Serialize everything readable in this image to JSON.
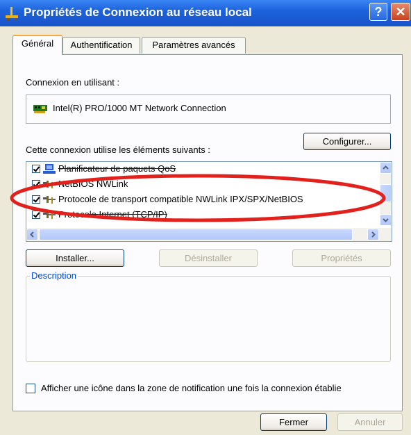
{
  "window": {
    "title": "Propriétés de Connexion au réseau local",
    "help_glyph": "?",
    "close_glyph": "✕"
  },
  "tabs": [
    {
      "label": "Général"
    },
    {
      "label": "Authentification"
    },
    {
      "label": "Paramètres avancés"
    }
  ],
  "general": {
    "connect_using_label": "Connexion en utilisant :",
    "adapter_name": "Intel(R) PRO/1000 MT Network Connection",
    "configure_button": "Configurer...",
    "items_label": "Cette connexion utilise les éléments suivants :",
    "items": [
      {
        "label": "Planificateur de paquets QoS",
        "checked": true,
        "icon": "scheduler-icon"
      },
      {
        "label": "NetBIOS NWLink",
        "checked": true,
        "icon": "protocol-icon"
      },
      {
        "label": "Protocole de transport compatible NWLink IPX/SPX/NetBIOS",
        "checked": true,
        "icon": "protocol-icon"
      },
      {
        "label": "Protocole Internet (TCP/IP)",
        "checked": true,
        "icon": "protocol-icon"
      }
    ],
    "install_button": "Installer...",
    "uninstall_button": "Désinstaller",
    "properties_button": "Propriétés",
    "description_label": "Description",
    "notify_checkbox_label": "Afficher une icône dans la zone de notification une fois la connexion établie",
    "notify_checked": false
  },
  "footer": {
    "close_button": "Fermer",
    "cancel_button": "Annuler"
  },
  "colors": {
    "titlebar": "#1d62dc",
    "dialog_bg": "#ece9d8",
    "annotation_ellipse": "#e3211c",
    "groupbox_label": "#0046d5"
  }
}
